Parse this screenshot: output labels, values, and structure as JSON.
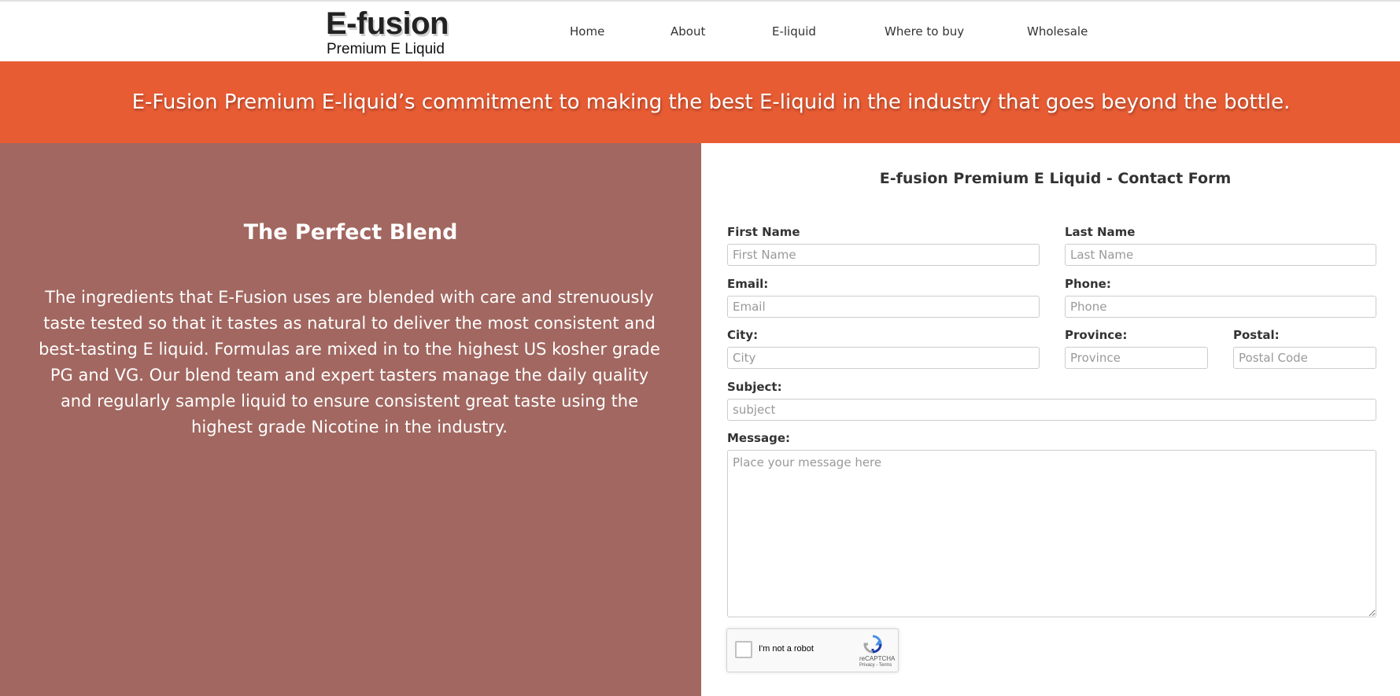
{
  "header": {
    "logo": {
      "title": "E-fusion",
      "subtitle": "Premium E Liquid"
    },
    "nav": [
      {
        "label": "Home"
      },
      {
        "label": "About"
      },
      {
        "label": "E-liquid"
      },
      {
        "label": "Where to buy"
      },
      {
        "label": "Wholesale"
      }
    ]
  },
  "banner": {
    "text": "E-Fusion Premium E-liquid’s commitment to making the best E-liquid in the industry that goes beyond the bottle."
  },
  "left_panel": {
    "title": "The Perfect Blend",
    "body": "The ingredients that E-Fusion uses are blended with care and strenuously taste tested so that it tastes as natural to deliver the most consistent and best-tasting E liquid. Formulas are mixed in to the highest US kosher grade PG and VG. Our blend team and expert tasters manage the daily quality and regularly sample liquid to ensure consistent great taste using the highest grade Nicotine in the industry."
  },
  "contact_form": {
    "title": "E-fusion Premium E Liquid - Contact Form",
    "first_name": {
      "label": "First Name",
      "placeholder": "First Name"
    },
    "last_name": {
      "label": "Last Name",
      "placeholder": "Last Name"
    },
    "email": {
      "label": "Email:",
      "placeholder": "Email"
    },
    "phone": {
      "label": "Phone:",
      "placeholder": "Phone"
    },
    "city": {
      "label": "City:",
      "placeholder": "City"
    },
    "province": {
      "label": "Province:",
      "placeholder": "Province"
    },
    "postal": {
      "label": "Postal:",
      "placeholder": "Postal Code"
    },
    "subject": {
      "label": "Subject:",
      "placeholder": "subject"
    },
    "message": {
      "label": "Message:",
      "placeholder": "Place your message here"
    },
    "captcha": {
      "label": "I'm not a robot",
      "brand": "reCAPTCHA",
      "links": "Privacy - Terms",
      "icon": "recaptcha-icon"
    }
  },
  "colors": {
    "banner": "#e85c34",
    "left_panel": "#a16760"
  }
}
